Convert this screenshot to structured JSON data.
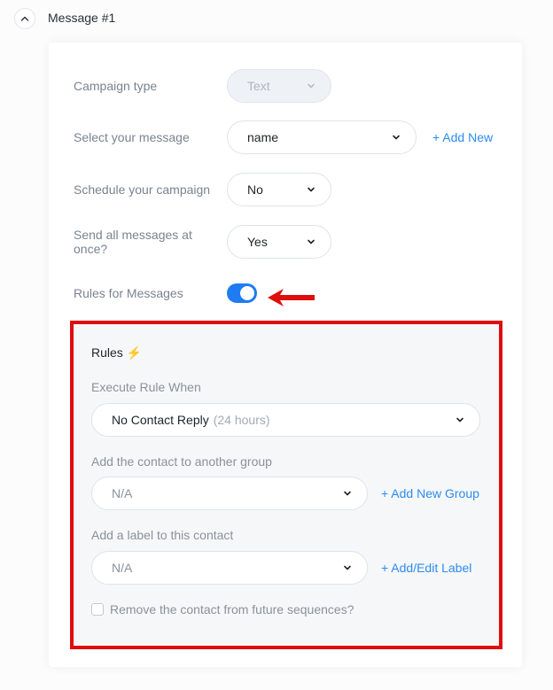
{
  "header": {
    "title": "Message #1"
  },
  "form": {
    "campaign_type": {
      "label": "Campaign type",
      "value": "Text"
    },
    "select_message": {
      "label": "Select your message",
      "value": "name",
      "add_label": "+ Add New"
    },
    "schedule": {
      "label": "Schedule your campaign",
      "value": "No"
    },
    "send_all": {
      "label_line1": "Send all messages at",
      "label_line2": "once?",
      "value": "Yes"
    },
    "rules_toggle": {
      "label": "Rules for Messages",
      "enabled": true
    }
  },
  "rules": {
    "title": "Rules",
    "bolt": "⚡",
    "execute": {
      "label": "Execute Rule When",
      "value": "No Contact Reply",
      "suffix": "(24 hours)"
    },
    "group": {
      "label": "Add the contact to another group",
      "value": "N/A",
      "add_label": "+ Add New Group"
    },
    "label": {
      "label": "Add a label to this contact",
      "value": "N/A",
      "add_label": "+ Add/Edit Label"
    },
    "remove": {
      "label": "Remove the contact from future sequences?",
      "checked": false
    }
  },
  "colors": {
    "accent": "#2d8cf0",
    "toggle_on": "#1e7bf2",
    "highlight": "#e00d0d"
  }
}
